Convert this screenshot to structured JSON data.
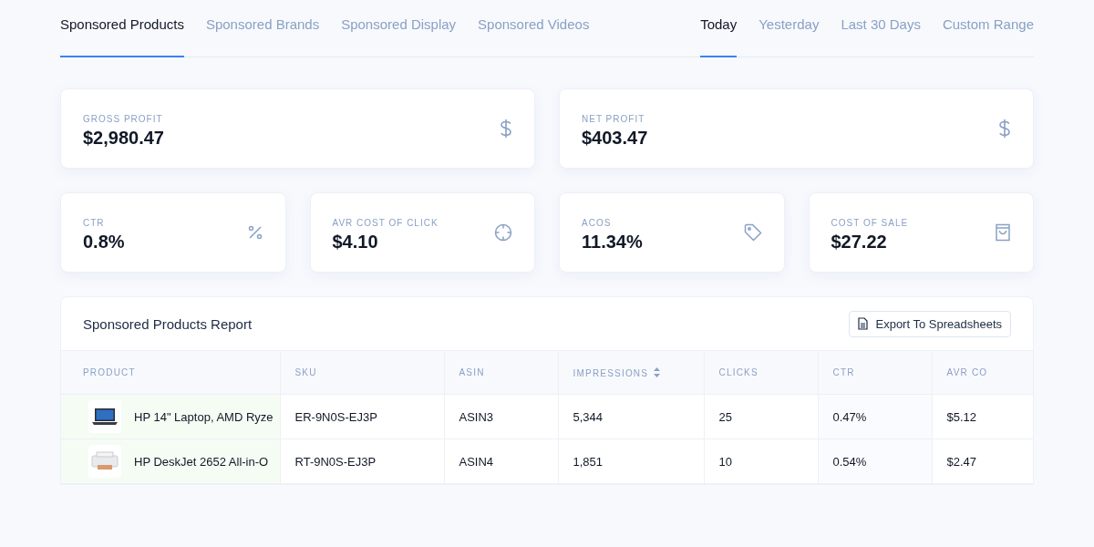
{
  "campaign_tabs": [
    {
      "label": "Sponsored Products",
      "selected": true
    },
    {
      "label": "Sponsored Brands",
      "selected": false
    },
    {
      "label": "Sponsored Display",
      "selected": false
    },
    {
      "label": "Sponsored Videos",
      "selected": false
    }
  ],
  "range_tabs": [
    {
      "label": "Today",
      "selected": true
    },
    {
      "label": "Yesterday",
      "selected": false
    },
    {
      "label": "Last 30 Days",
      "selected": false
    },
    {
      "label": "Custom Range",
      "selected": false
    }
  ],
  "wide_stats": [
    {
      "label": "GROSS PROFIT",
      "value": "$2,980.47",
      "kind": "dollar"
    },
    {
      "label": "NET PROFIT",
      "value": "$403.47",
      "kind": "dollar"
    }
  ],
  "stats": [
    {
      "label": "CTR",
      "value": "0.8%",
      "kind": "percent"
    },
    {
      "label": "AVR COST OF CLICK",
      "value": "$4.10",
      "kind": "crosshair"
    },
    {
      "label": "ACOS",
      "value": "11.34%",
      "kind": "tag"
    },
    {
      "label": "COST OF SALE",
      "value": "$27.22",
      "kind": "bag"
    }
  ],
  "report": {
    "title": "Sponsored Products Report",
    "export_button": "Export To Spreadsheets",
    "columns": [
      {
        "label": "PRODUCT",
        "sortable": false
      },
      {
        "label": "SKU",
        "sortable": false
      },
      {
        "label": "ASIN",
        "sortable": false
      },
      {
        "label": "IMPRESSIONS",
        "sortable": true
      },
      {
        "label": "CLICKS",
        "sortable": false
      },
      {
        "label": "CTR",
        "sortable": false
      },
      {
        "label": "AVR CO",
        "sortable": false
      }
    ],
    "rows": [
      {
        "kind": "laptop",
        "cells": [
          "HP 14\" Laptop, AMD Ryze",
          "ER-9N0S-EJ3P",
          "ASIN3",
          "5,344",
          "25",
          "0.47%",
          "$5.12"
        ]
      },
      {
        "kind": "printer",
        "cells": [
          "HP DeskJet 2652 All-in-O",
          "RT-9N0S-EJ3P",
          "ASIN4",
          "1,851",
          "10",
          "0.54%",
          "$2.47"
        ]
      }
    ]
  }
}
